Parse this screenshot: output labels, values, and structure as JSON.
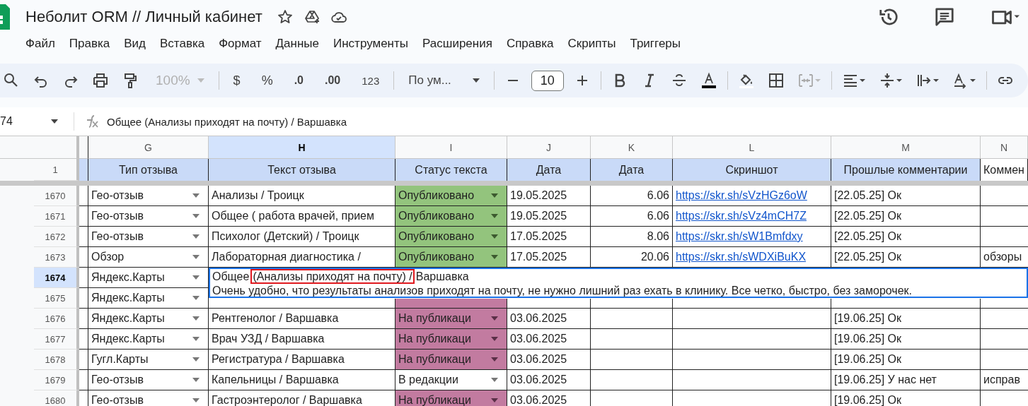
{
  "document": {
    "title": "Неболит ORM // Личный кабинет"
  },
  "menu": [
    "Файл",
    "Правка",
    "Вид",
    "Вставка",
    "Формат",
    "Данные",
    "Инструменты",
    "Расширения",
    "Справка",
    "Скрипты",
    "Триггеры"
  ],
  "toolbar": {
    "zoom": "100%",
    "currency": "$",
    "percent": "%",
    "decrease_decimals": ".0",
    "increase_decimals": ".00",
    "number_format": "123",
    "font": "По ум...",
    "font_size": "10"
  },
  "formula_bar": {
    "cell_ref": "74",
    "value": "Общее (Анализы приходят на почту) / Варшавка"
  },
  "columns": [
    {
      "letter": "G",
      "heading": "Тип отзыва",
      "selected": false
    },
    {
      "letter": "H",
      "heading": "Текст отзыва",
      "selected": true
    },
    {
      "letter": "I",
      "heading": "Статус текста",
      "selected": false
    },
    {
      "letter": "J",
      "heading": "Дата",
      "selected": false
    },
    {
      "letter": "K",
      "heading": "Дата",
      "selected": false
    },
    {
      "letter": "L",
      "heading": "Скриншот",
      "selected": false
    },
    {
      "letter": "M",
      "heading": "Прошлые комментарии",
      "selected": false
    },
    {
      "letter": "N",
      "heading": "Коммен",
      "selected": false
    }
  ],
  "header_row_number": "1",
  "rows": [
    {
      "number": "1670",
      "selected": false,
      "type": "Гео-отзыв",
      "text": "Анализы / Троицк",
      "status": {
        "kind": "published",
        "label": "Опубликовано"
      },
      "date": "19.05.2025",
      "k": "6.06",
      "link": "https://skr.sh/sVzHGz6oW",
      "comment": "[22.05.25] Ок"
    },
    {
      "number": "1671",
      "selected": false,
      "type": "Гео-отзыв",
      "text": "Общее ( работа врачей, прием",
      "status": {
        "kind": "published",
        "label": "Опубликовано"
      },
      "date": "19.05.2025",
      "k": "6.06",
      "link": "https://skr.sh/sVz4mCH7Z",
      "comment": "[22.05.25] Ок"
    },
    {
      "number": "1672",
      "selected": false,
      "type": "Гео-отзыв",
      "text": "Психолог (Детский) / Троицк",
      "status": {
        "kind": "published",
        "label": "Опубликовано"
      },
      "date": "17.05.2025",
      "k": "8.06",
      "link": "https://skr.sh/sW1Bmfdxy",
      "comment": "[22.05.25] Ок"
    },
    {
      "number": "1673",
      "selected": false,
      "type": "Обзор",
      "text": "Лабораторная диагностика /",
      "status": {
        "kind": "published",
        "label": "Опубликовано"
      },
      "date": "17.05.2025",
      "k": "20.06",
      "link": "https://skr.sh/sWDXiBuKX",
      "comment": "[22.05.25] Ок",
      "n": "обзоры"
    },
    {
      "number": "1674",
      "selected": true,
      "type": "Яндекс.Карты"
    },
    {
      "number": "1675",
      "selected": false,
      "type": "Яндекс.Карты",
      "status": {
        "kind": "publishing"
      }
    },
    {
      "number": "1676",
      "selected": false,
      "type": "Яндекс.Карты",
      "text": "Рентгенолог / Варшавка",
      "status": {
        "kind": "publishing",
        "label": "На публикаци"
      },
      "date": "03.06.2025",
      "comment": "[19.06.25] Ок"
    },
    {
      "number": "1677",
      "selected": false,
      "type": "Яндекс.Карты",
      "text": "Врач УЗД / Варшавка",
      "status": {
        "kind": "publishing",
        "label": "На публикаци"
      },
      "date": "03.06.2025",
      "comment": "[19.06.25] Ок"
    },
    {
      "number": "1678",
      "selected": false,
      "type": "Гугл.Карты",
      "text": "Регистратура / Варшавка",
      "status": {
        "kind": "publishing",
        "label": "На публикаци"
      },
      "date": "03.06.2025",
      "comment": "[19.06.25] Ок"
    },
    {
      "number": "1679",
      "selected": false,
      "type": "Гео-отзыв",
      "text": "Капельницы / Варшавка",
      "status": {
        "kind": "editing",
        "label": "В редакции"
      },
      "date": "03.06.2025",
      "comment": "[19.06.25] У нас нет",
      "n": "исправ"
    },
    {
      "number": "1680",
      "selected": false,
      "type": "Гео-отзыв",
      "text": "Гастроэнтеролог / Варшавка",
      "status": {
        "kind": "publishing",
        "label": "На публикаци"
      },
      "date": "03.06.2025",
      "comment": "[19.06.25] Ок"
    }
  ],
  "cell_editor": {
    "line_1": {
      "before": "Общее",
      "highlighted": "(Анализы приходят на почту) /",
      "after": "Варшавка"
    },
    "line_2": "Очень удобно, что результаты анализов приходят на почту, не нужно лишний раз ехать в клинику. Все четко, быстро, без заморочек."
  }
}
